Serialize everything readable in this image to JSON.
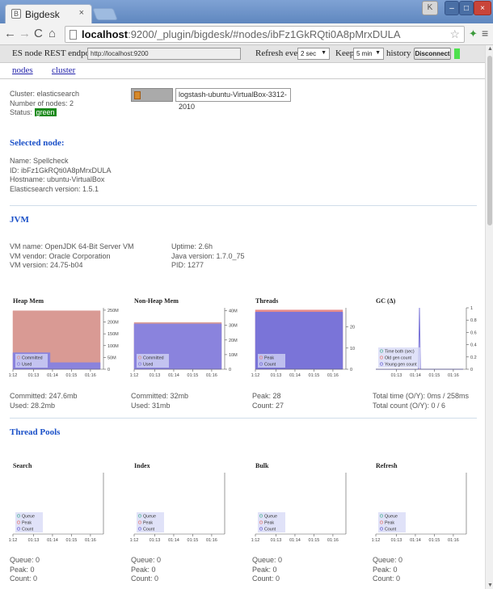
{
  "browser": {
    "tab_title": "Bigdesk",
    "url_host": "localhost",
    "url_rest": ":9200/_plugin/bigdesk/#nodes/ibFz1GkRQti0A8pMrxDULA",
    "profile_letter": "K"
  },
  "topbar": {
    "endpoint_label": "ES node REST endpoint",
    "endpoint_value": "http://localhost:9200",
    "refresh_label": "Refresh every",
    "refresh_value": "2 sec",
    "keep_label": "Keep",
    "keep_value": "5 min",
    "history_label": "history",
    "disconnect_label": "Disconnect"
  },
  "tabs": {
    "nodes": "nodes",
    "cluster": "cluster"
  },
  "cluster": {
    "name_line": "Cluster: elasticsearch",
    "nodes_line": "Number of nodes: 2",
    "status_label": "Status:",
    "status_value": "green"
  },
  "node_buttons": {
    "selected": "Spellcheck",
    "other": "logstash-ubuntu-VirtualBox-3312-2010"
  },
  "selected_node": {
    "title": "Selected node:",
    "name": "Name: Spellcheck",
    "id": "ID: ibFz1GkRQti0A8pMrxDULA",
    "hostname": "Hostname: ubuntu-VirtualBox",
    "version": "Elasticsearch version: 1.5.1"
  },
  "jvm": {
    "title": "JVM",
    "vm_name": "VM name: OpenJDK 64-Bit Server VM",
    "vm_vendor": "VM vendor: Oracle Corporation",
    "vm_version": "VM version: 24.75-b04",
    "uptime": "Uptime: 2.6h",
    "java_version": "Java version: 1.7.0_75",
    "pid": "PID: 1277"
  },
  "jvm_stats": {
    "heap_committed": "Committed: 247.6mb",
    "heap_used": "Used: 28.2mb",
    "nonheap_committed": "Committed: 32mb",
    "nonheap_used": "Used: 31mb",
    "threads_peak": "Peak: 28",
    "threads_count": "Count: 27",
    "gc_time": "Total time (O/Y): 0ms / 258ms",
    "gc_count": "Total count (O/Y): 0 / 6"
  },
  "thread_pools": {
    "title": "Thread Pools",
    "stats": [
      {
        "queue": "Queue: 0",
        "peak": "Peak: 0",
        "count": "Count: 0"
      },
      {
        "queue": "Queue: 0",
        "peak": "Peak: 0",
        "count": "Count: 0"
      },
      {
        "queue": "Queue: 0",
        "peak": "Peak: 0",
        "count": "Count: 0"
      },
      {
        "queue": "Queue: 0",
        "peak": "Peak: 0",
        "count": "Count: 0"
      }
    ]
  },
  "colors": {
    "committed": "#d99a94",
    "used": "#8a83dd",
    "peak": "#e58a8a",
    "count": "#7a74d8",
    "green": "#1b8a1b",
    "accent": "#1a50c8"
  },
  "chart_data": [
    {
      "type": "area",
      "title": "Heap Mem",
      "x_ticks": [
        "1:12",
        "01:13",
        "01:14",
        "01:15",
        "01:16"
      ],
      "y_ticks": [
        "0",
        "50M",
        "100M",
        "150M",
        "200M",
        "250M"
      ],
      "ylim": [
        0,
        260
      ],
      "x": [
        0,
        0.2,
        0.6,
        1.6,
        2.0,
        3.0,
        4.0,
        4.7
      ],
      "series": [
        {
          "name": "Committed",
          "color": "#d99a94",
          "values": [
            247.6,
            247.6,
            247.6,
            247.6,
            247.6,
            247.6,
            247.6,
            247.6
          ]
        },
        {
          "name": "Used",
          "color": "#8a83dd",
          "values": [
            70,
            70,
            70,
            70,
            28,
            28,
            28,
            28.2
          ]
        }
      ],
      "legend": [
        "Committed",
        "Used"
      ]
    },
    {
      "type": "area",
      "title": "Non-Heap Mem",
      "x_ticks": [
        "1:12",
        "01:13",
        "01:14",
        "01:15",
        "01:16"
      ],
      "y_ticks": [
        "0",
        "10M",
        "20M",
        "30M",
        "40M"
      ],
      "ylim": [
        0,
        42
      ],
      "x": [
        0,
        4.7
      ],
      "series": [
        {
          "name": "Committed",
          "color": "#d99a94",
          "values": [
            32,
            32
          ]
        },
        {
          "name": "Used",
          "color": "#8a83dd",
          "values": [
            31,
            31
          ]
        }
      ],
      "legend": [
        "Committed",
        "Used"
      ]
    },
    {
      "type": "area",
      "title": "Threads",
      "x_ticks": [
        "1:12",
        "01:13",
        "01:14",
        "01:15",
        "01:16"
      ],
      "y_ticks": [
        "0",
        "10",
        "20"
      ],
      "ylim": [
        0,
        29
      ],
      "x": [
        0,
        4.7
      ],
      "series": [
        {
          "name": "Peak",
          "color": "#e58a8a",
          "values": [
            28,
            28
          ]
        },
        {
          "name": "Count",
          "color": "#7a74d8",
          "values": [
            27,
            27
          ]
        }
      ],
      "legend": [
        "Peak",
        "Count"
      ]
    },
    {
      "type": "line",
      "title": "GC (Δ)",
      "x_ticks": [
        "01:13",
        "01:14",
        "01:15",
        "01:16"
      ],
      "y_ticks": [
        "0",
        "0.2",
        "0.4",
        "0.6",
        "0.8",
        "1"
      ],
      "ylim": [
        0,
        1
      ],
      "x": [
        0,
        2.3,
        2.35,
        2.4,
        4.7
      ],
      "series": [
        {
          "name": "Time both (sec)",
          "color": "#62b8a4",
          "values": [
            0,
            0,
            0,
            0,
            0
          ]
        },
        {
          "name": "Old gen count",
          "color": "#e58a8a",
          "values": [
            0,
            0,
            0,
            0,
            0
          ]
        },
        {
          "name": "Young gen count",
          "color": "#7a74d8",
          "values": [
            0,
            0,
            1,
            0,
            0
          ]
        }
      ],
      "legend": [
        "Time both (sec)",
        "Old gen count",
        "Young gen count"
      ]
    },
    {
      "type": "line",
      "title": "Search",
      "x_ticks": [
        "1:12",
        "01:13",
        "01:14",
        "01:15",
        "01:16"
      ],
      "y_ticks": [],
      "series": [
        {
          "name": "Queue",
          "color": "#62b8a4",
          "values": [
            0,
            0
          ]
        },
        {
          "name": "Peak",
          "color": "#e58a8a",
          "values": [
            0,
            0
          ]
        },
        {
          "name": "Count",
          "color": "#7a74d8",
          "values": [
            0,
            0
          ]
        }
      ],
      "legend": [
        "Queue",
        "Peak",
        "Count"
      ]
    },
    {
      "type": "line",
      "title": "Index",
      "x_ticks": [
        "1:12",
        "01:13",
        "01:14",
        "01:15",
        "01:16"
      ],
      "y_ticks": [],
      "series": [
        {
          "name": "Queue",
          "color": "#62b8a4",
          "values": [
            0,
            0
          ]
        },
        {
          "name": "Peak",
          "color": "#e58a8a",
          "values": [
            0,
            0
          ]
        },
        {
          "name": "Count",
          "color": "#7a74d8",
          "values": [
            0,
            0
          ]
        }
      ],
      "legend": [
        "Queue",
        "Peak",
        "Count"
      ]
    },
    {
      "type": "line",
      "title": "Bulk",
      "x_ticks": [
        "1:12",
        "01:13",
        "01:14",
        "01:15",
        "01:16"
      ],
      "y_ticks": [],
      "series": [
        {
          "name": "Queue",
          "color": "#62b8a4",
          "values": [
            0,
            0
          ]
        },
        {
          "name": "Peak",
          "color": "#e58a8a",
          "values": [
            0,
            0
          ]
        },
        {
          "name": "Count",
          "color": "#7a74d8",
          "values": [
            0,
            0
          ]
        }
      ],
      "legend": [
        "Queue",
        "Peak",
        "Count"
      ]
    },
    {
      "type": "line",
      "title": "Refresh",
      "x_ticks": [
        "1:12",
        "01:13",
        "01:14",
        "01:15",
        "01:16"
      ],
      "y_ticks": [],
      "series": [
        {
          "name": "Queue",
          "color": "#62b8a4",
          "values": [
            0,
            0
          ]
        },
        {
          "name": "Peak",
          "color": "#e58a8a",
          "values": [
            0,
            0
          ]
        },
        {
          "name": "Count",
          "color": "#7a74d8",
          "values": [
            0,
            0
          ]
        }
      ],
      "legend": [
        "Queue",
        "Peak",
        "Count"
      ]
    }
  ]
}
